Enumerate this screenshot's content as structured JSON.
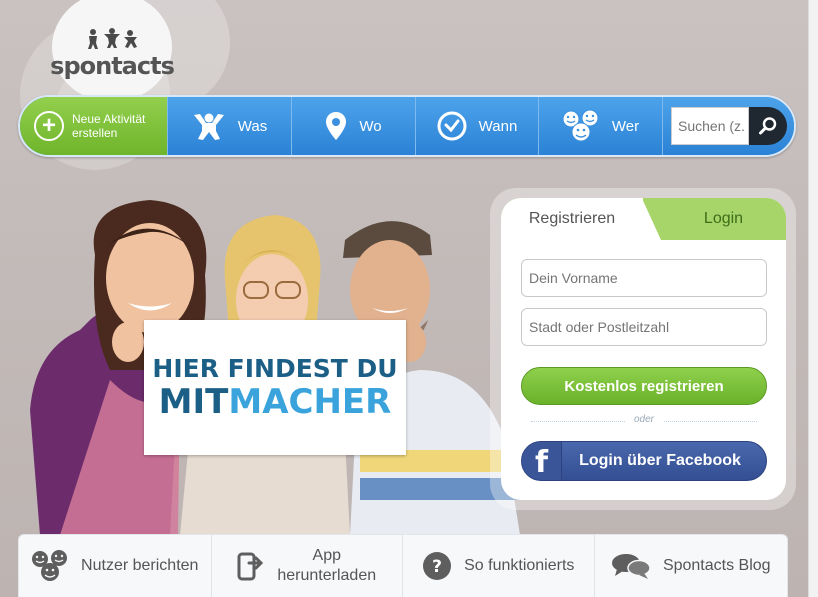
{
  "logo": {
    "text": "spontacts",
    "figures": "☃☺☃"
  },
  "nav": {
    "new_activity": {
      "line1": "Neue Aktivität",
      "line2": "erstellen",
      "icon": "plus-circle-icon"
    },
    "was": {
      "label": "Was",
      "icon": "jumping-person-icon"
    },
    "wo": {
      "label": "Wo",
      "icon": "location-pin-icon"
    },
    "wann": {
      "label": "Wann",
      "icon": "clock-icon"
    },
    "wer": {
      "label": "Wer",
      "icon": "smiley-faces-icon"
    },
    "search": {
      "placeholder": "Suchen (z.",
      "icon": "magnifier-icon"
    }
  },
  "hero": {
    "sign_line1": "HIER FINDEST DU",
    "sign_mit": "MIT",
    "sign_macher": "MACHER",
    "colors": {
      "dark": "#1c5f86",
      "light": "#3aa3dc"
    }
  },
  "registration": {
    "tab_register": "Registrieren",
    "tab_login": "Login",
    "first_name_placeholder": "Dein Vorname",
    "city_placeholder": "Stadt oder Postleitzahl",
    "register_button": "Kostenlos registrieren",
    "or_text": "oder",
    "facebook_button": "Login über Facebook",
    "colors": {
      "green": "#7cc13a",
      "facebook": "#3b5998"
    }
  },
  "bottom_bar": {
    "items": [
      {
        "label": "Nutzer berichten",
        "icon": "smiley-group-icon"
      },
      {
        "label_line1": "App",
        "label_line2": "herunterladen",
        "icon": "phone-download-icon"
      },
      {
        "label": "So funktionierts",
        "icon": "question-circle-icon"
      },
      {
        "label": "Spontacts Blog",
        "icon": "speech-bubbles-icon"
      }
    ]
  }
}
